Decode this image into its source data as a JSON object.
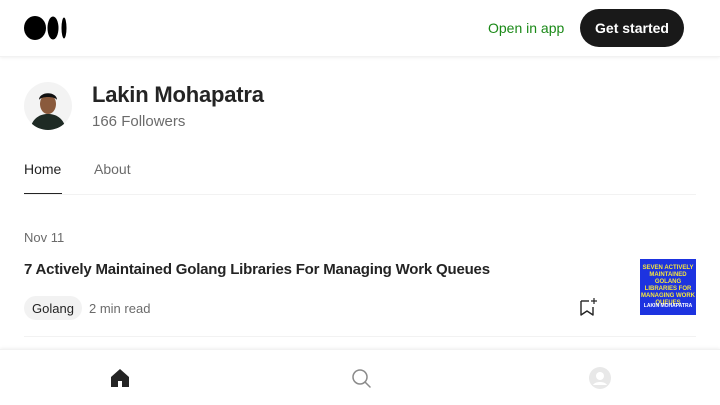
{
  "header": {
    "logo": "medium-logo",
    "open_in_app": "Open in app",
    "get_started": "Get started"
  },
  "profile": {
    "name": "Lakin Mohapatra",
    "followers": "166 Followers"
  },
  "tabs": [
    {
      "label": "Home",
      "active": true
    },
    {
      "label": "About",
      "active": false
    }
  ],
  "article": {
    "date": "Nov 11",
    "title": "7 Actively Maintained Golang Libraries For Managing Work Queues",
    "tag": "Golang",
    "read_time": "2 min read",
    "thumbnail": {
      "text": "SEVEN ACTIVELY MAINTAINED GOLANG LIBRARIES FOR MANAGING WORK QUEUES",
      "author": "LAKIN MOHAPATRA"
    }
  },
  "bottom_nav": {
    "items": [
      "home-icon",
      "search-icon",
      "profile-icon"
    ]
  },
  "colors": {
    "accent_green": "#1a8917",
    "button_dark": "#191919",
    "thumb_blue": "#1d33e0",
    "thumb_yellow": "#f5e63c"
  }
}
